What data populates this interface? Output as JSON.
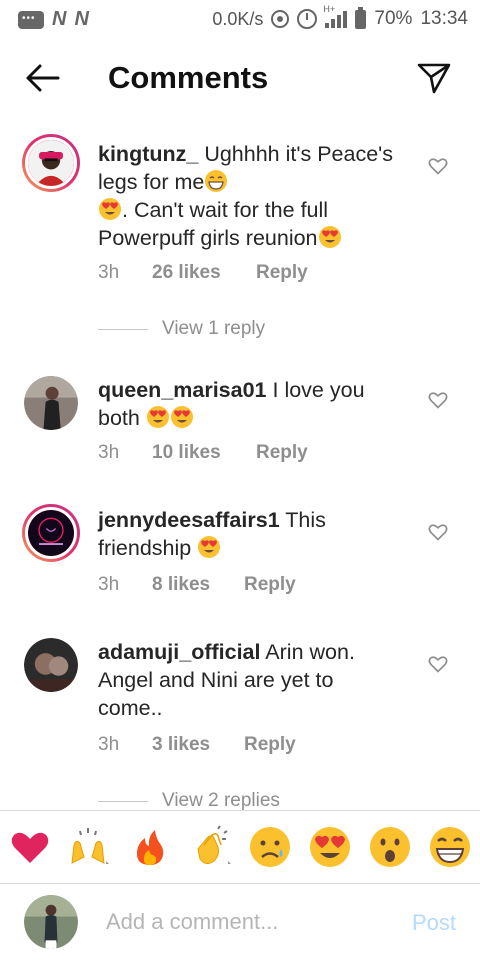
{
  "status_bar": {
    "n_label": "N",
    "speed": "0.0K/s",
    "network": "H+",
    "battery": "70%",
    "time": "13:34"
  },
  "header": {
    "title": "Comments",
    "back_icon": "arrow-left-icon",
    "send_icon": "paper-plane-icon"
  },
  "comments": [
    {
      "username": "kingtunz_",
      "text_1": "Ughhhh it's Peace's legs for me",
      "text_2": ". Can't wait for the full Powerpuff girls reunion",
      "time": "3h",
      "likes": "26 likes",
      "reply": "Reply",
      "view_replies": "View 1 reply"
    },
    {
      "username": "queen_marisa01",
      "text_1": "I love you both",
      "time": "3h",
      "likes": "10 likes",
      "reply": "Reply"
    },
    {
      "username": "jennydeesaffairs1",
      "text_1": "This friendship",
      "time": "3h",
      "likes": "8 likes",
      "reply": "Reply"
    },
    {
      "username": "adamuji_official",
      "text_1": "Arin won. Angel and Nini are yet to come..",
      "time": "3h",
      "likes": "3 likes",
      "reply": "Reply",
      "view_replies": "View 2 replies"
    }
  ],
  "reactions": [
    "red-heart-icon",
    "raising-hands-icon",
    "fire-icon",
    "clapping-hands-icon",
    "sad-face-icon",
    "heart-eyes-icon",
    "surprised-face-icon",
    "grinning-face-icon"
  ],
  "input": {
    "placeholder": "Add a comment...",
    "post_label": "Post"
  },
  "colors": {
    "accent": "#3897f0",
    "post_disabled": "#b3dbff",
    "muted": "#8e8e8e",
    "emoji_yellow": "#fbc02d",
    "heart_red": "#e0245e"
  }
}
